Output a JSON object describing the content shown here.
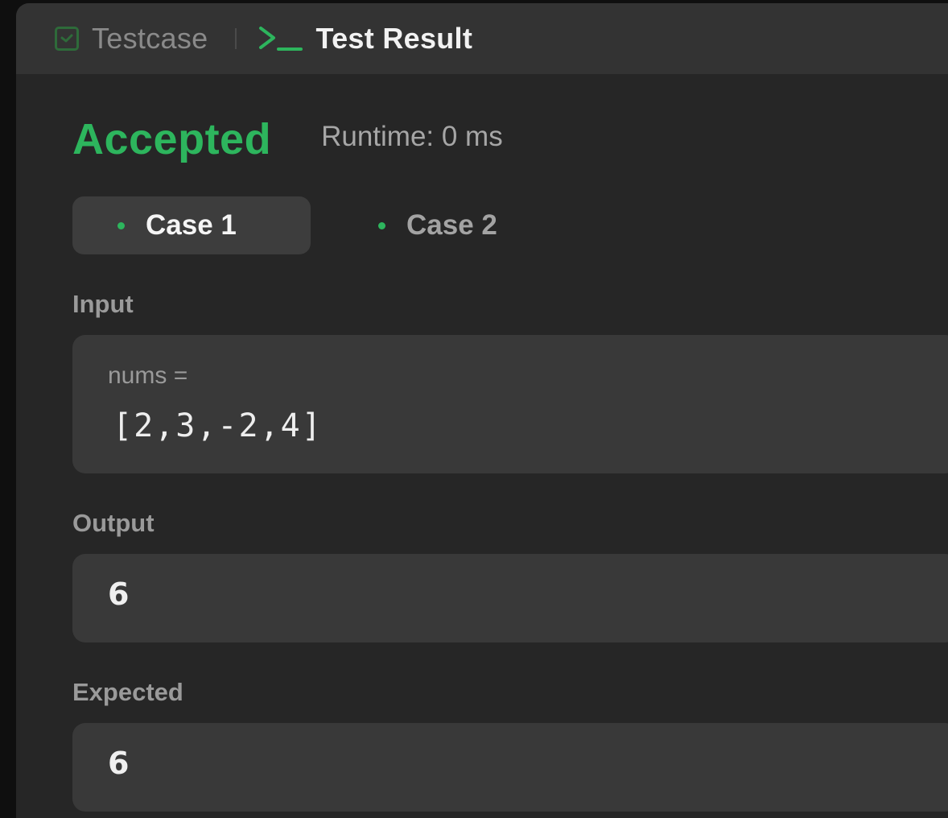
{
  "tabs": {
    "testcase_label": "Testcase",
    "test_result_label": "Test Result"
  },
  "result": {
    "status": "Accepted",
    "runtime": "Runtime: 0 ms"
  },
  "cases": [
    {
      "label": "Case 1",
      "selected": true
    },
    {
      "label": "Case 2",
      "selected": false
    }
  ],
  "input": {
    "label": "Input",
    "var_name": "nums =",
    "var_value": "[2,3,-2,4]"
  },
  "output": {
    "label": "Output",
    "value": "6"
  },
  "expected": {
    "label": "Expected",
    "value": "6"
  },
  "colors": {
    "accent_green": "#2db55d",
    "panel_bg": "#262626",
    "tabbar_bg": "#333333",
    "box_bg": "#393939"
  },
  "icons": {
    "testcase": "checkbox-icon",
    "test_result": "terminal-icon"
  }
}
